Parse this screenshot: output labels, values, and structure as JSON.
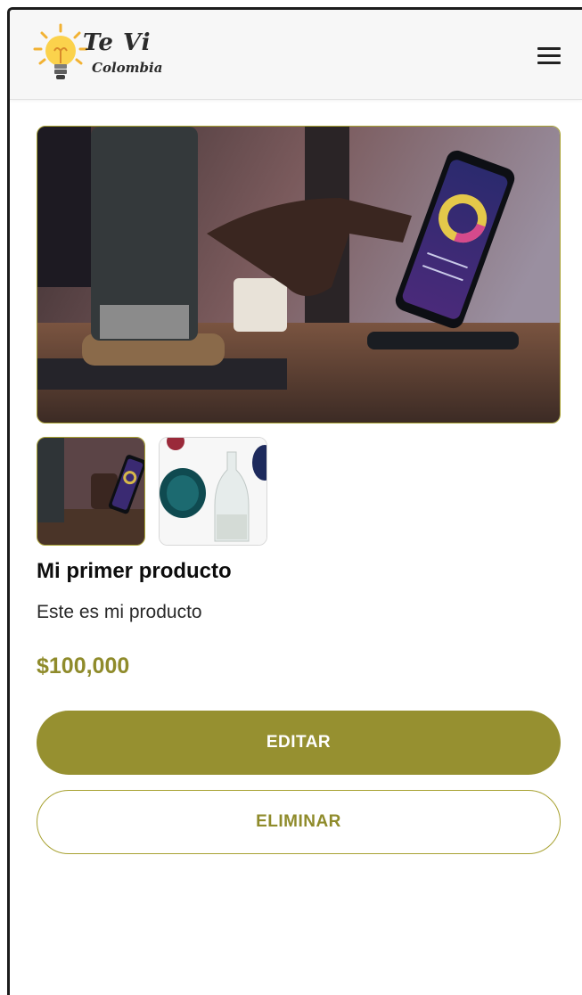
{
  "header": {
    "logo_line1": "Te Vi",
    "logo_line2": "Colombia",
    "menu_icon": "hamburger-menu-icon"
  },
  "product": {
    "title": "Mi primer producto",
    "description": "Este es mi producto",
    "price": "$100,000",
    "images": [
      {
        "name": "main-product-image",
        "subject": "hand-tapping-smartphone-on-charging-stand"
      },
      {
        "name": "thumbnail-1",
        "subject": "hand-tapping-smartphone-on-charging-stand"
      },
      {
        "name": "thumbnail-2",
        "subject": "glass-bottle-and-teal-coasters"
      }
    ]
  },
  "actions": {
    "edit_label": "EDITAR",
    "delete_label": "ELIMINAR"
  },
  "colors": {
    "accent": "#969030",
    "accent_border": "#a8a232",
    "price": "#8f8b2b"
  }
}
